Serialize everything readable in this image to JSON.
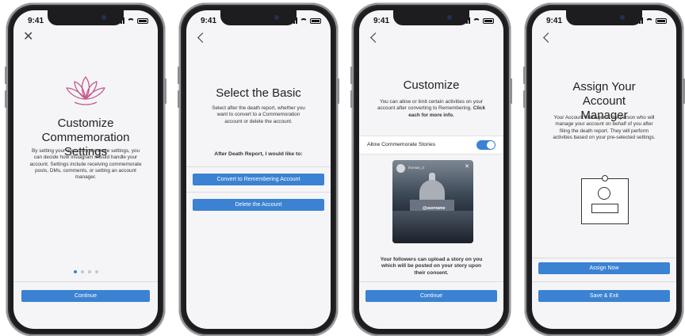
{
  "status_time": "9:41",
  "screens": [
    {
      "title": "Customize Commemoration Settings",
      "body": "By setting your own commemorate settings, you can decide how Instagram should handle your account. Settings include receiving commemorate posts, DMs, comments, or setting an account manager.",
      "continue_label": "Continue",
      "page_dots": 4,
      "active_dot": 1
    },
    {
      "title": "Select the Basic",
      "body": "Select after the death report, whether you want to convert to a Commemoration account or delete the account.",
      "prompt": "After Death Report, I would like to:",
      "convert_label": "Convert to Remembering Account",
      "delete_label": "Delete the Account"
    },
    {
      "title": "Customize",
      "body": "You can allow or limit certain activities on your account after converting to Remembering.",
      "body_bold": "Click each for more info.",
      "toggle_label": "Allow Commemorate Stories",
      "toggle_on": true,
      "story_username": "thomas_d",
      "story_tag": "@username",
      "caption": "Your followers can upload a story on you which will be posted on your story upon their consent.",
      "continue_label": "Continue"
    },
    {
      "title": "Assign Your Account Manager",
      "body": "Your Account Manager is the person who will manage your account on behalf of you after filing the death report. They will perform activities based on your pre-selected settings.",
      "assign_label": "Assign Now",
      "save_label": "Save & Exit"
    }
  ],
  "colors": {
    "accent": "#3b82d2",
    "lotus": "#c45a8e"
  }
}
